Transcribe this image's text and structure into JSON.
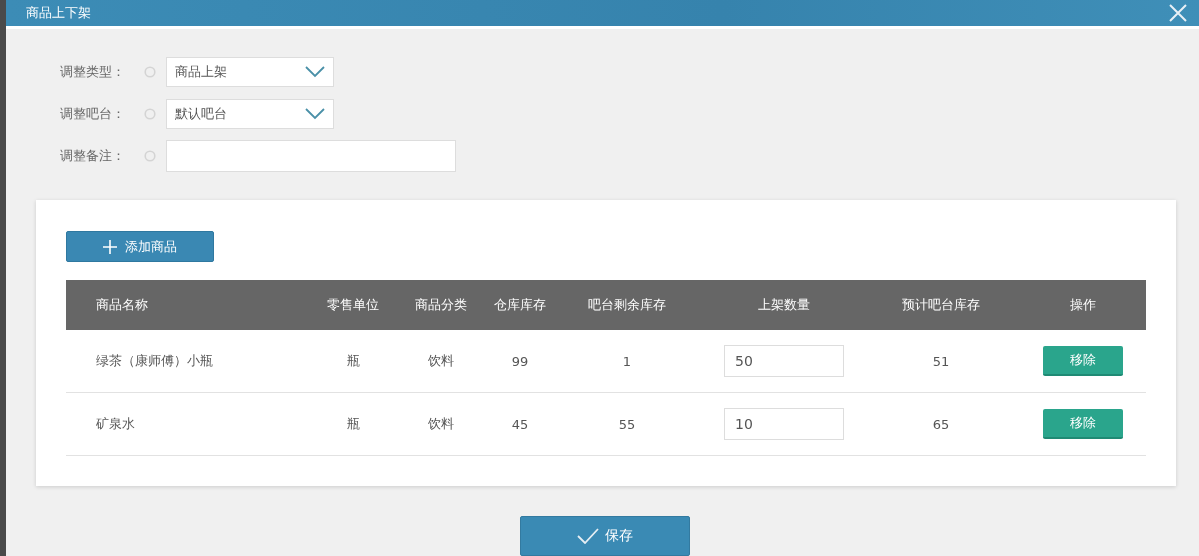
{
  "dialog": {
    "title": "商品上下架"
  },
  "form": [
    {
      "kind": "select",
      "label": "调整类型：",
      "value": "商品上架"
    },
    {
      "kind": "select",
      "label": "调整吧台：",
      "value": "默认吧台"
    },
    {
      "kind": "text",
      "label": "调整备注："
    }
  ],
  "add_button": "添加商品",
  "table": {
    "columns": [
      "商品名称",
      "零售单位",
      "商品分类",
      "仓库库存",
      "吧台剩余库存",
      "上架数量",
      "预计吧台库存",
      "操作"
    ],
    "rows": [
      {
        "name": "绿茶（康师傅）小瓶",
        "unit": "瓶",
        "category": "饮料",
        "warehouse_stock": "99",
        "bar_stock": "1",
        "quantity": "50",
        "expected_stock": "51",
        "action": "移除"
      },
      {
        "name": "矿泉水",
        "unit": "瓶",
        "category": "饮料",
        "warehouse_stock": "45",
        "bar_stock": "55",
        "quantity": "10",
        "expected_stock": "65",
        "action": "移除"
      }
    ]
  },
  "save_button": "保存"
}
